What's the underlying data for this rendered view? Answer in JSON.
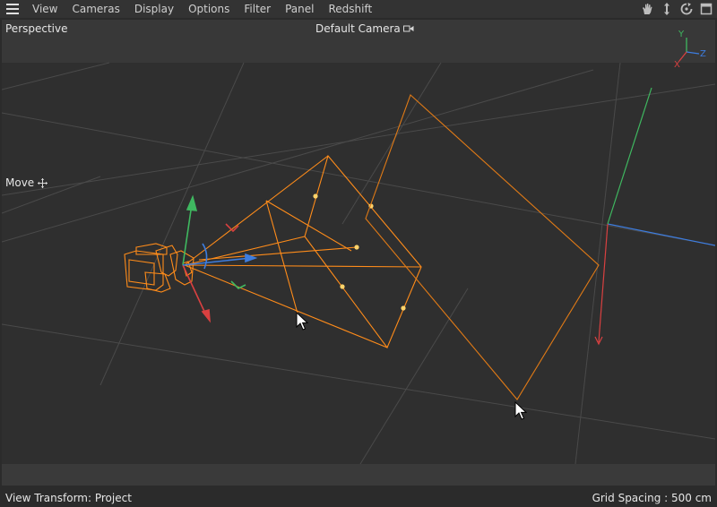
{
  "menubar": {
    "items": [
      "View",
      "Cameras",
      "Display",
      "Options",
      "Filter",
      "Panel",
      "Redshift"
    ],
    "nav_icons": [
      "pan-hand-icon",
      "move-arrows-icon",
      "rotate-icon",
      "maximize-view-icon"
    ]
  },
  "viewport": {
    "projection": "Perspective",
    "camera": "Default Camera",
    "tool": "Move",
    "view_transform": "View Transform: Project",
    "grid_spacing": "Grid Spacing : 500 cm"
  },
  "axis_gizmo": {
    "x": "X",
    "y": "Y",
    "z": "Z"
  },
  "colors": {
    "selection_orange": "#ff8c1a",
    "axis_x": "#d94040",
    "axis_y": "#3fb860",
    "axis_z": "#3d7de0",
    "background": "#2f2f2f"
  }
}
